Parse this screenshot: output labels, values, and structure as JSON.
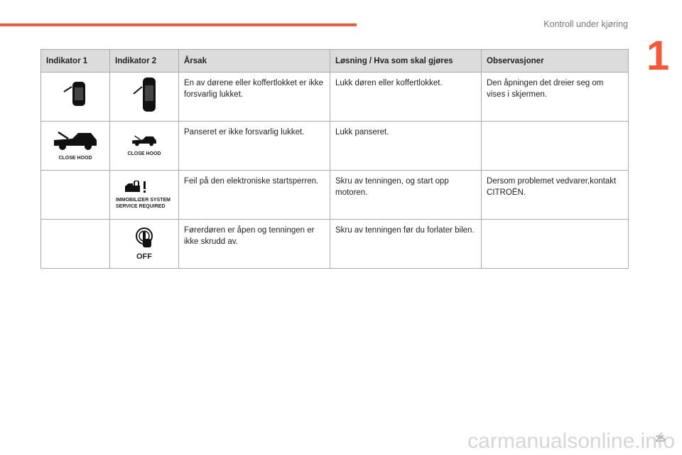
{
  "header": {
    "section_title": "Kontroll under kjøring",
    "chapter": "1",
    "accent": "#f15a3b"
  },
  "table": {
    "columns": [
      "Indikator 1",
      "Indikator 2",
      "Årsak",
      "Løsning / Hva som skal gjøres",
      "Observasjoner"
    ],
    "rows": [
      {
        "icon1": "door-open-car-icon",
        "icon2": "door-open-car-icon",
        "cause": "En av dørene eller koffertlokket er ikke forsvarlig lukket.",
        "solution": "Lukk døren eller koffertlokket.",
        "notes": "Den åpningen det dreier seg om vises i skjermen."
      },
      {
        "icon1": "hood-open-icon",
        "icon1_label": "CLOSE HOOD",
        "icon2": "hood-open-icon",
        "icon2_label": "CLOSE HOOD",
        "cause": "Panseret er ikke forsvarlig lukket.",
        "solution": "Lukk panseret.",
        "notes": ""
      },
      {
        "icon2": "immobilizer-icon",
        "icon2_label": "IMMOBILIZER SYSTEM SERVICE REQUIRED",
        "cause": "Feil på den elektroniske startsperren.",
        "solution": "Skru av tenningen, og start opp motoren.",
        "notes": "Dersom problemet vedvarer,kontakt CITROËN."
      },
      {
        "icon2": "ignition-button-icon",
        "icon2_label": "OFF",
        "cause": "Førerdøren er åpen og tenningen er ikke skrudd av.",
        "solution": "Skru av tenningen før du forlater bilen.",
        "notes": ""
      }
    ]
  },
  "footer": {
    "page_number": "25",
    "watermark": "carmanualsonline.info"
  }
}
